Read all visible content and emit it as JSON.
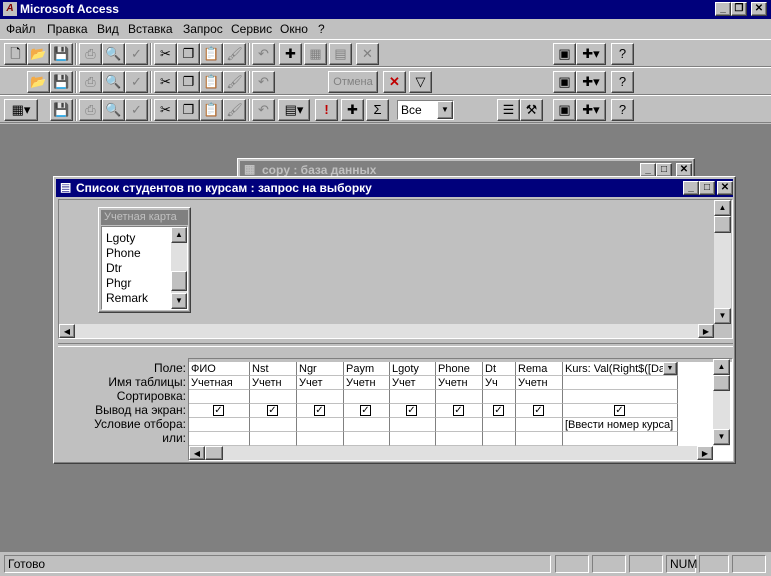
{
  "app": {
    "title": "Microsoft Access"
  },
  "menu": [
    "Файл",
    "Правка",
    "Вид",
    "Вставка",
    "Запрос",
    "Сервис",
    "Окно",
    "?"
  ],
  "toolbar2": {
    "cancel_label": "Отмена"
  },
  "toolbar3": {
    "query_type_value": "Все"
  },
  "db_window": {
    "title": "copy : база данных"
  },
  "query_window": {
    "title": "Список студентов по курсам : запрос на выборку"
  },
  "field_list": {
    "title": "Учетная карта",
    "fields": [
      "Lgoty",
      "Phone",
      "Dtr",
      "Phgr",
      "Remark"
    ]
  },
  "grid": {
    "row_labels": [
      "Поле:",
      "Имя таблицы:",
      "Сортировка:",
      "Вывод на экран:",
      "Условие отбора:",
      "или:"
    ],
    "columns": [
      {
        "field": "ФИО",
        "table": "Учетная",
        "show": true,
        "criteria": ""
      },
      {
        "field": "Nst",
        "table": "Учетн",
        "show": true,
        "criteria": ""
      },
      {
        "field": "Ngr",
        "table": "Учет",
        "show": true,
        "criteria": ""
      },
      {
        "field": "Paym",
        "table": "Учетн",
        "show": true,
        "criteria": ""
      },
      {
        "field": "Lgoty",
        "table": "Учет",
        "show": true,
        "criteria": ""
      },
      {
        "field": "Phone",
        "table": "Учетн",
        "show": true,
        "criteria": ""
      },
      {
        "field": "Dt",
        "table": "Уч",
        "show": true,
        "criteria": ""
      },
      {
        "field": "Rema",
        "table": "Учетн",
        "show": true,
        "criteria": ""
      },
      {
        "field": "Kurs: Val(Right$([Da",
        "table": "",
        "show": true,
        "criteria": "[Ввести номер курса]"
      }
    ]
  },
  "status": {
    "text": "Готово",
    "num": "NUM"
  },
  "icons": [
    "new-icon",
    "open-icon",
    "save-icon",
    "print-icon",
    "preview-icon",
    "spell-icon",
    "cut-icon",
    "copy-icon",
    "paste-icon",
    "format-painter-icon",
    "undo-icon",
    "new-object-icon",
    "close-icon",
    "filter-icon",
    "run-icon",
    "sigma-icon",
    "properties-icon",
    "build-icon",
    "database-window-icon",
    "help-icon"
  ]
}
